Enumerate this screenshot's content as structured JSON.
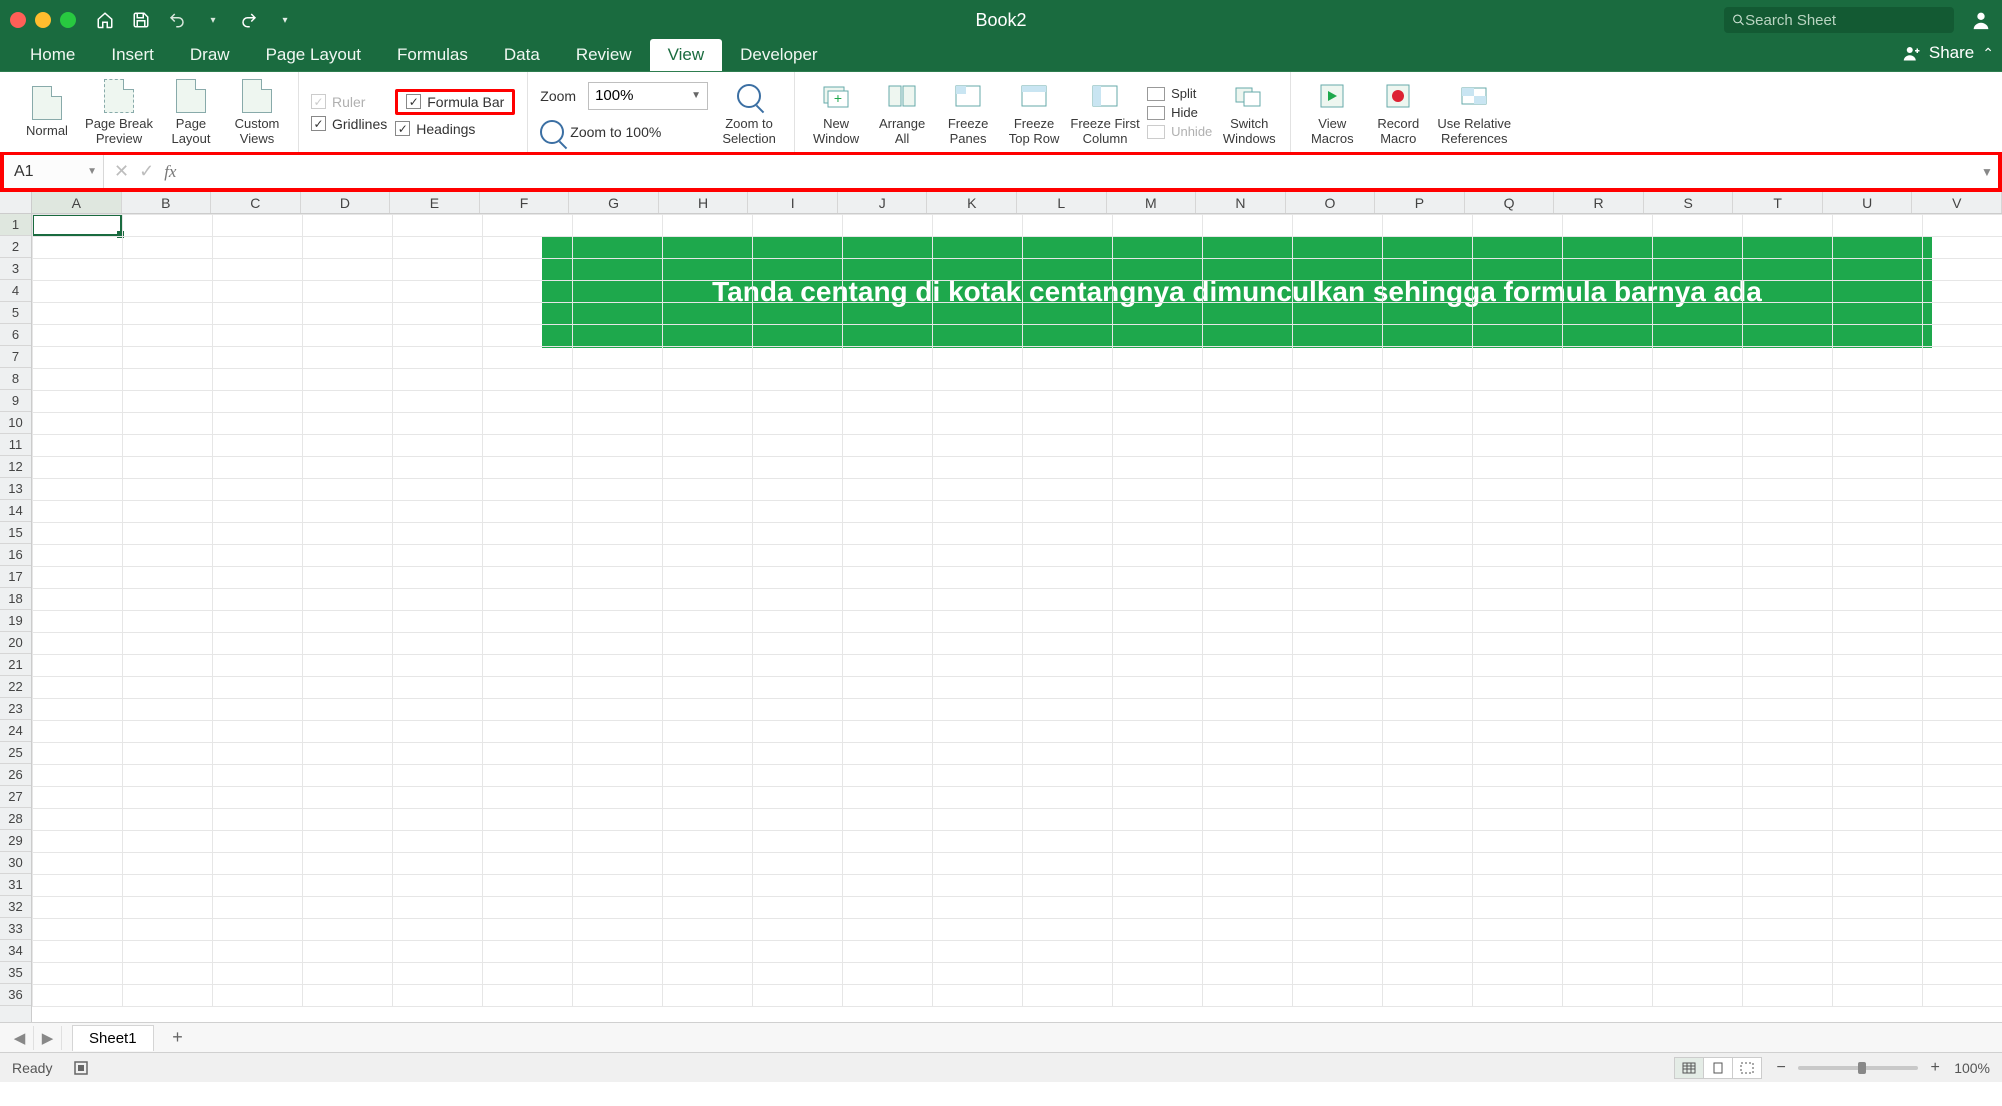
{
  "titlebar": {
    "title": "Book2",
    "search_placeholder": "Search Sheet"
  },
  "tabs": {
    "items": [
      "Home",
      "Insert",
      "Draw",
      "Page Layout",
      "Formulas",
      "Data",
      "Review",
      "View",
      "Developer"
    ],
    "active_index": 7,
    "share_label": "Share"
  },
  "ribbon": {
    "views": {
      "normal": "Normal",
      "page_break": "Page Break\nPreview",
      "page_layout": "Page\nLayout",
      "custom": "Custom\nViews"
    },
    "show": {
      "ruler": "Ruler",
      "formula_bar": "Formula Bar",
      "gridlines": "Gridlines",
      "headings": "Headings",
      "ruler_checked": true,
      "formula_bar_checked": true,
      "gridlines_checked": true,
      "headings_checked": true
    },
    "zoom": {
      "label": "Zoom",
      "value": "100%",
      "to100": "Zoom to 100%",
      "to_selection": "Zoom to\nSelection"
    },
    "window": {
      "new": "New\nWindow",
      "arrange": "Arrange\nAll",
      "freeze_panes": "Freeze\nPanes",
      "freeze_top": "Freeze\nTop Row",
      "freeze_first": "Freeze First\nColumn",
      "split": "Split",
      "hide": "Hide",
      "unhide": "Unhide",
      "switch": "Switch\nWindows"
    },
    "macros": {
      "view": "View\nMacros",
      "record": "Record\nMacro",
      "relative": "Use Relative\nReferences"
    }
  },
  "formula_bar": {
    "name_box": "A1",
    "cancel": "✕",
    "enter": "✓",
    "fx": "fx",
    "value": ""
  },
  "grid": {
    "columns": [
      "A",
      "B",
      "C",
      "D",
      "E",
      "F",
      "G",
      "H",
      "I",
      "J",
      "K",
      "L",
      "M",
      "N",
      "O",
      "P",
      "Q",
      "R",
      "S",
      "T",
      "U",
      "V"
    ],
    "rows": 36,
    "active_cell": "A1",
    "callout_text": "Tanda centang di kotak centangnya dimunculkan  sehingga formula barnya ada"
  },
  "sheets": {
    "tabs": [
      "Sheet1"
    ],
    "active_index": 0
  },
  "status": {
    "ready": "Ready",
    "zoom": "100%"
  }
}
